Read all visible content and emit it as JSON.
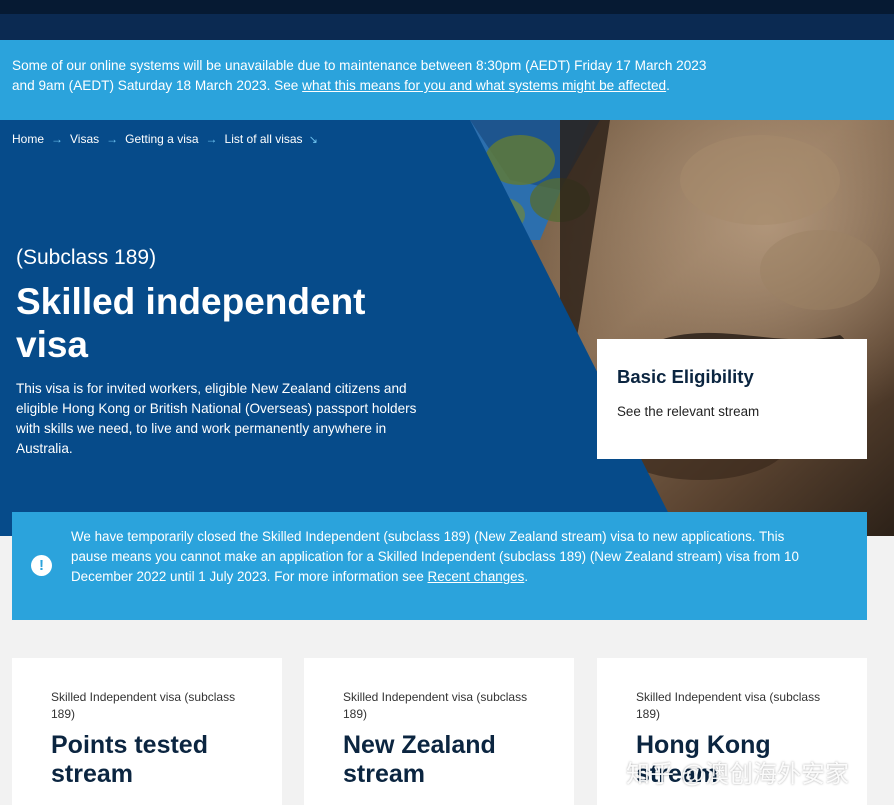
{
  "maintenance": {
    "line1": "Some of our online systems will be unavailable due to maintenance between 8:30pm (AEDT) Friday 17 March 2023",
    "line2_prefix": "and 9am (AEDT) Saturday 18 March 2023. See ",
    "link_text": "what this means for you and what systems might be affected",
    "line2_suffix": "."
  },
  "breadcrumb": {
    "items": [
      "Home",
      "Visas",
      "Getting a visa",
      "List of all visas"
    ]
  },
  "hero": {
    "subclass": "(Subclass 189)",
    "title": "Skilled independent visa",
    "intro": "This visa is for invited workers, eligible New Zealand citizens and eligible Hong Kong or British National (Overseas) passport holders with skills we need, to live and work permanently anywhere in Australia."
  },
  "eligibility": {
    "heading": "Basic Eligibility",
    "text": "See the relevant stream"
  },
  "alert": {
    "text": "We have temporarily closed the Skilled Independent (subclass 189) (New Zealand stream) visa to new applications. This pause means you cannot make an application for a Skilled Independent (subclass 189) (New Zealand stream) visa from 10 December 2022 until 1 July 2023. For more information see ",
    "link_text": "Recent changes",
    "suffix": "."
  },
  "streams": [
    {
      "eyebrow": "Skilled Independent visa (subclass 189)",
      "title": "Points tested stream"
    },
    {
      "eyebrow": "Skilled Independent visa (subclass 189)",
      "title": "New Zealand stream"
    },
    {
      "eyebrow": "Skilled Independent visa (subclass 189)",
      "title": "Hong Kong stream"
    }
  ],
  "watermark": "知乎 @澳创海外安家",
  "colors": {
    "hero_blue": "#064b8a",
    "banner_blue": "#2ba3dc",
    "navy_text": "#0b2540"
  },
  "icons": {
    "breadcrumb_separator": "arrow-right-icon",
    "breadcrumb_end": "arrow-down-right-icon",
    "alert": "exclamation-circle-icon"
  }
}
